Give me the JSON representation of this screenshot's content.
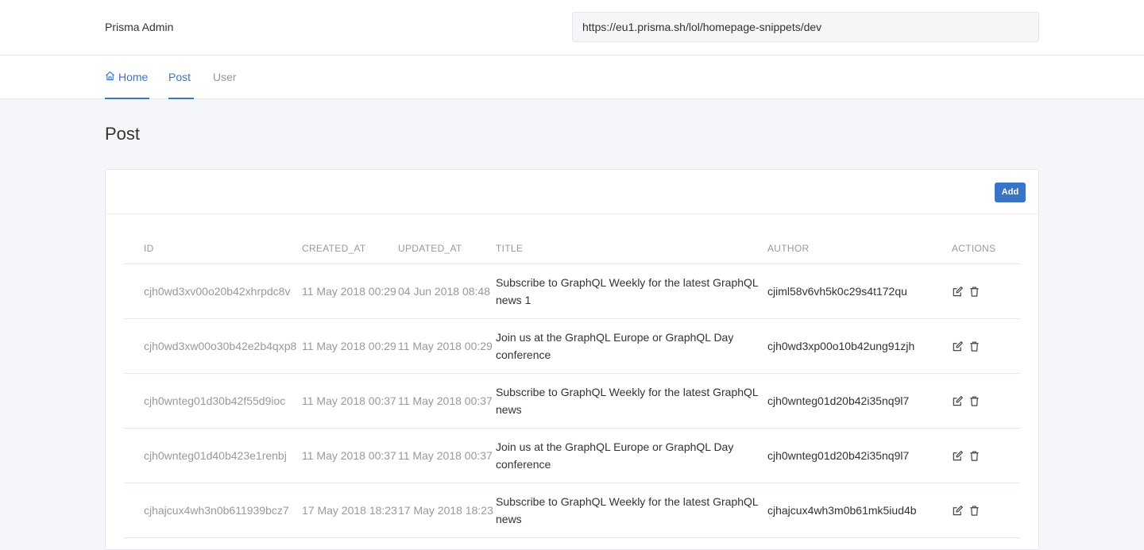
{
  "header": {
    "brand": "Prisma Admin",
    "endpoint_value": "https://eu1.prisma.sh/lol/homepage-snippets/dev"
  },
  "nav": {
    "tabs": [
      {
        "label": "Home",
        "icon": "home-icon"
      },
      {
        "label": "Post"
      },
      {
        "label": "User"
      }
    ]
  },
  "page": {
    "title": "Post",
    "add_label": "Add"
  },
  "table": {
    "columns": [
      "ID",
      "CREATED_AT",
      "UPDATED_AT",
      "TITLE",
      "AUTHOR",
      "ACTIONS"
    ],
    "rows": [
      {
        "id": "cjh0wd3xv00o20b42xhrpdc8v",
        "created": "11 May 2018 00:29",
        "updated": "04 Jun 2018 08:48",
        "title": "Subscribe to GraphQL Weekly for the latest GraphQL news 1",
        "author": "cjiml58v6vh5k0c29s4t172qu"
      },
      {
        "id": "cjh0wd3xw00o30b42e2b4qxp8",
        "created": "11 May 2018 00:29",
        "updated": "11 May 2018 00:29",
        "title": "Join us at the GraphQL Europe or GraphQL Day conference",
        "author": "cjh0wd3xp00o10b42ung91zjh"
      },
      {
        "id": "cjh0wnteg01d30b42f55d9ioc",
        "created": "11 May 2018 00:37",
        "updated": "11 May 2018 00:37",
        "title": "Subscribe to GraphQL Weekly for the latest GraphQL news",
        "author": "cjh0wnteg01d20b42i35nq9l7"
      },
      {
        "id": "cjh0wnteg01d40b423e1renbj",
        "created": "11 May 2018 00:37",
        "updated": "11 May 2018 00:37",
        "title": "Join us at the GraphQL Europe or GraphQL Day conference",
        "author": "cjh0wnteg01d20b42i35nq9l7"
      },
      {
        "id": "cjhajcux4wh3n0b611939bcz7",
        "created": "17 May 2018 18:23",
        "updated": "17 May 2018 18:23",
        "title": "Subscribe to GraphQL Weekly for the latest GraphQL news",
        "author": "cjhajcux4wh3m0b61mk5iud4b"
      }
    ],
    "row_actions": [
      "edit-icon",
      "trash-icon"
    ]
  },
  "colors": {
    "accent": "#3a74c4",
    "muted_text": "#999999",
    "background": "#f4f6f9"
  }
}
